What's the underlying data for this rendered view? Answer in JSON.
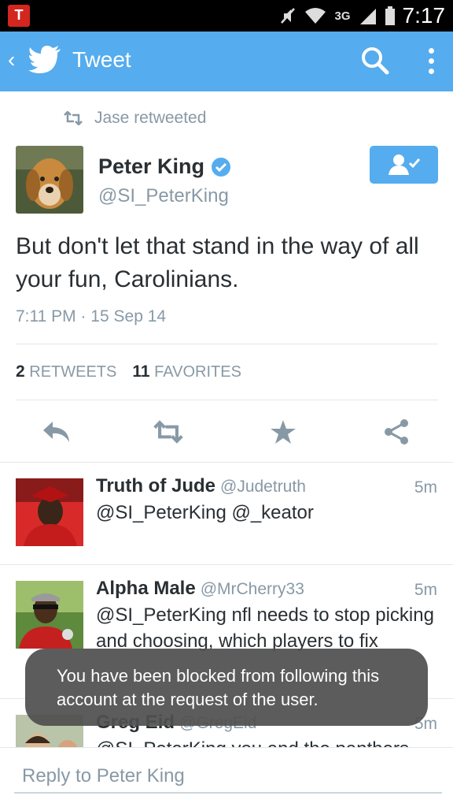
{
  "status_bar": {
    "network": "3G",
    "time": "7:17",
    "app_icon_letter": "T"
  },
  "app_bar": {
    "back_icon": "chevron-left-icon",
    "title": "Tweet",
    "search_icon": "search-icon",
    "more_icon": "more-vert-icon"
  },
  "tweet": {
    "retweeted_by": "Jase retweeted",
    "author_name": "Peter King",
    "author_handle": "@SI_PeterKing",
    "text": "But don't let that stand in the way of all your fun, Carolinians.",
    "timestamp": "7:11 PM · 15 Sep 14",
    "retweets_count": "2",
    "retweets_label": "RETWEETS",
    "favorites_count": "11",
    "favorites_label": "FAVORITES"
  },
  "replies": [
    {
      "name": "Truth of Jude",
      "handle": "@Judetruth",
      "time": "5m",
      "text": "@SI_PeterKing @_keator"
    },
    {
      "name": "Alpha Male",
      "handle": "@MrCherry33",
      "time": "5m",
      "text": "@SI_PeterKing nfl needs to stop picking and choosing, which players to fix"
    },
    {
      "name": "Greg Eid",
      "handle": "@GregEid",
      "time": "5m",
      "text": "@SI_PeterKing you and the panthers"
    }
  ],
  "toast": {
    "message": "You have been blocked from following this account at the request of the user."
  },
  "reply_bar": {
    "placeholder": "Reply to Peter King"
  },
  "colors": {
    "brand": "#55acee",
    "text": "#292f33",
    "muted": "#8899a6",
    "divider": "#e1e8ed"
  }
}
